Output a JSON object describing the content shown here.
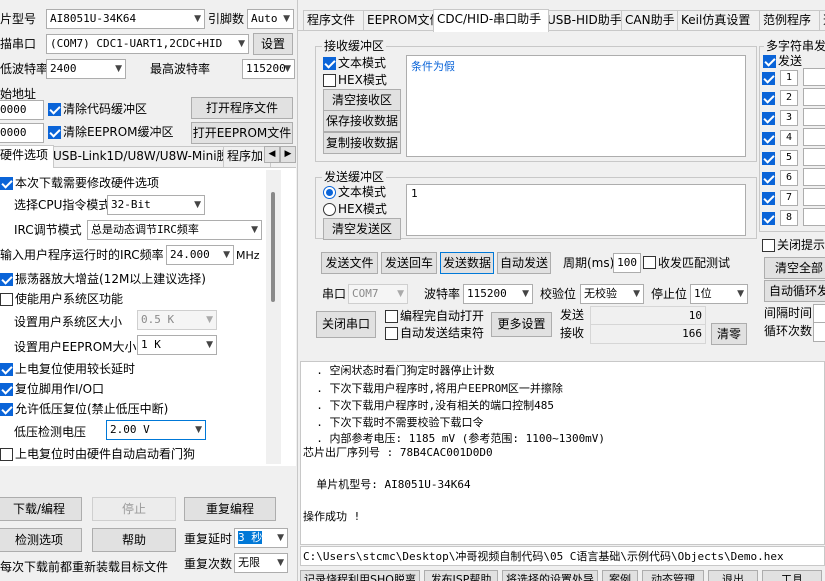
{
  "top_left": {
    "mcu_model_label": "片型号",
    "mcu_model_value": "AI8051U-34K64",
    "pin_count_label": "引脚数",
    "pin_count_value": "Auto",
    "scan_port_label": "描串口",
    "scan_port_value": "(COM7) CDC1-UART1,2CDC+HID",
    "settings_button": "设置",
    "min_baud_label": "低波特率",
    "min_baud_value": "2400",
    "max_baud_label": "最高波特率",
    "max_baud_value": "115200",
    "start_addr_label": "始地址",
    "addr1_value": "0000",
    "clear_code_buffer_label": "清除代码缓冲区",
    "open_program_button": "打开程序文件",
    "addr2_value": "0000",
    "clear_eeprom_buffer_label": "清除EEPROM缓冲区",
    "open_eeprom_button": "打开EEPROM文件"
  },
  "left_tabs": [
    "硬件选项",
    "USB-Link1D/U8W/U8W-Mini脱机",
    "程序加"
  ],
  "hw_options": {
    "modify_hw_label": "本次下载需要修改硬件选项",
    "cpu_mode_label": "选择CPU指令模式",
    "cpu_mode_value": "32-Bit",
    "irc_mode_label": "IRC调节模式",
    "irc_mode_value": "总是动态调节IRC频率",
    "irc_freq_label": "输入用户程序运行时的IRC频率",
    "irc_freq_value": "24.000",
    "irc_freq_unit": "MHz",
    "osc_gain_label": "振荡器放大增益(12M以上建议选择)",
    "user_sys_area_label": "使能用户系统区功能",
    "user_sys_size_label": "设置用户系统区大小",
    "user_sys_size_value": "0.5  K",
    "user_eeprom_size_label": "设置用户EEPROM大小",
    "user_eeprom_size_value": "1   K",
    "long_reset_delay_label": "上电复位使用较长延时",
    "reset_pin_io_label": "复位脚用作I/O口",
    "low_volt_reset_label": "允许低压复位(禁止低压中断)",
    "low_volt_detect_label": "低压检测电压",
    "low_volt_detect_value": "2.00 V",
    "watchdog_label": "上电复位时由硬件自动启动看门狗"
  },
  "bottom_left": {
    "download_button": "下载/编程",
    "stop_button": "停止",
    "reprogram_button": "重复编程",
    "detect_button": "检测选项",
    "help_button": "帮助",
    "repeat_delay_label": "重复延时",
    "repeat_delay_value": "3 秒",
    "repeat_count_label": "重复次数",
    "repeat_count_value": "无限",
    "reload_label": "每次下载前都重新装载目标文件"
  },
  "right_tabs": [
    "程序文件",
    "EEPROM文件",
    "CDC/HID-串口助手",
    "USB-HID助手",
    "CAN助手",
    "Keil仿真设置",
    "范例程序",
    "选"
  ],
  "receive": {
    "title": "接收缓冲区",
    "text_mode_label": "文本模式",
    "hex_mode_label": "HEX模式",
    "clear_button": "清空接收区",
    "save_button": "保存接收数据",
    "copy_button": "复制接收数据",
    "content": "条件为假"
  },
  "send": {
    "title": "发送缓冲区",
    "text_mode_label": "文本模式",
    "hex_mode_label": "HEX模式",
    "clear_button": "清空发送区",
    "content": "1"
  },
  "send_actions": {
    "send_file": "发送文件",
    "send_return": "发送回车",
    "send_data": "发送数据",
    "auto_send": "自动发送",
    "period_label": "周期(ms)",
    "period_value": "100",
    "loopback_label": "收发匹配测试"
  },
  "port_settings": {
    "port_label": "串口",
    "port_value": "COM7",
    "baud_label": "波特率",
    "baud_value": "115200",
    "parity_label": "校验位",
    "parity_value": "无校验",
    "stop_label": "停止位",
    "stop_value": "1位",
    "close_port_button": "关闭串口",
    "auto_open_label": "编程完自动打开",
    "auto_send_end_label": "自动发送结束符",
    "more_settings_button": "更多设置",
    "send_count_label": "发送",
    "send_count_value": "10",
    "recv_count_label": "接收",
    "recv_count_value": "166",
    "clear_count_button": "清零"
  },
  "multi_string": {
    "title": "多字符串发",
    "send_label": "发送",
    "items": [
      "1",
      "2",
      "3",
      "4",
      "5",
      "6",
      "7",
      "8"
    ],
    "close_tip_label": "关闭提示",
    "clear_all_button": "清空全部",
    "auto_loop_button": "自动循环发",
    "interval_label": "间隔时间",
    "loop_count_label": "循环次数"
  },
  "log": {
    "lines": [
      "  . 空闲状态时看门狗定时器停止计数",
      "  . 下次下载用户程序时,将用户EEPROM区一并擦除",
      "  . 下次下载用户程序时,没有相关的端口控制485",
      "  . 下次下载时不需要校验下载口令",
      "  . 内部参考电压: 1185 mV (参考范围: 1100~1300mV)",
      "芯片出厂序列号 : 78B4CAC001D0D0",
      "",
      "  单片机型号: AI8051U-34K64",
      "",
      "操作成功 !"
    ]
  },
  "status": {
    "file_path": "C:\\Users\\stcmc\\Desktop\\冲哥视频自制代码\\05 C语言基础\\示例代码\\Objects\\Demo.hex",
    "bottom_items": [
      "记录烧程利用SHQ脱离",
      "发布ISP帮助",
      "将选择的设置处导",
      "案例",
      "动态管理",
      "退出",
      "工具"
    ]
  },
  "colors": {
    "accent": "#0a64d8",
    "window_bg": "#f0f0f0",
    "selection": "#0078d7"
  }
}
